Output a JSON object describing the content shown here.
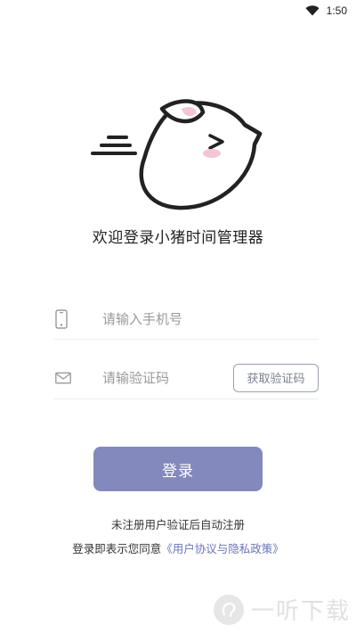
{
  "status_bar": {
    "time": "1:50",
    "wifi_icon": "wifi-icon"
  },
  "mascot": {
    "icon": "running-pig-icon",
    "accent_color": "#f4c6d3"
  },
  "welcome_text": "欢迎登录小猪时间管理器",
  "phone_field": {
    "icon": "phone-icon",
    "placeholder": "请输入手机号",
    "value": ""
  },
  "code_field": {
    "icon": "mail-icon",
    "placeholder": "请输验证码",
    "value": "",
    "get_code_label": "获取验证码"
  },
  "login_button": {
    "label": "登录",
    "color": "#8389bd"
  },
  "hint_text": "未注册用户验证后自动注册",
  "agreement": {
    "prefix": "登录即表示您同意",
    "link": "《用户协议与隐私政策》"
  },
  "watermark": {
    "text": "一听下载"
  }
}
